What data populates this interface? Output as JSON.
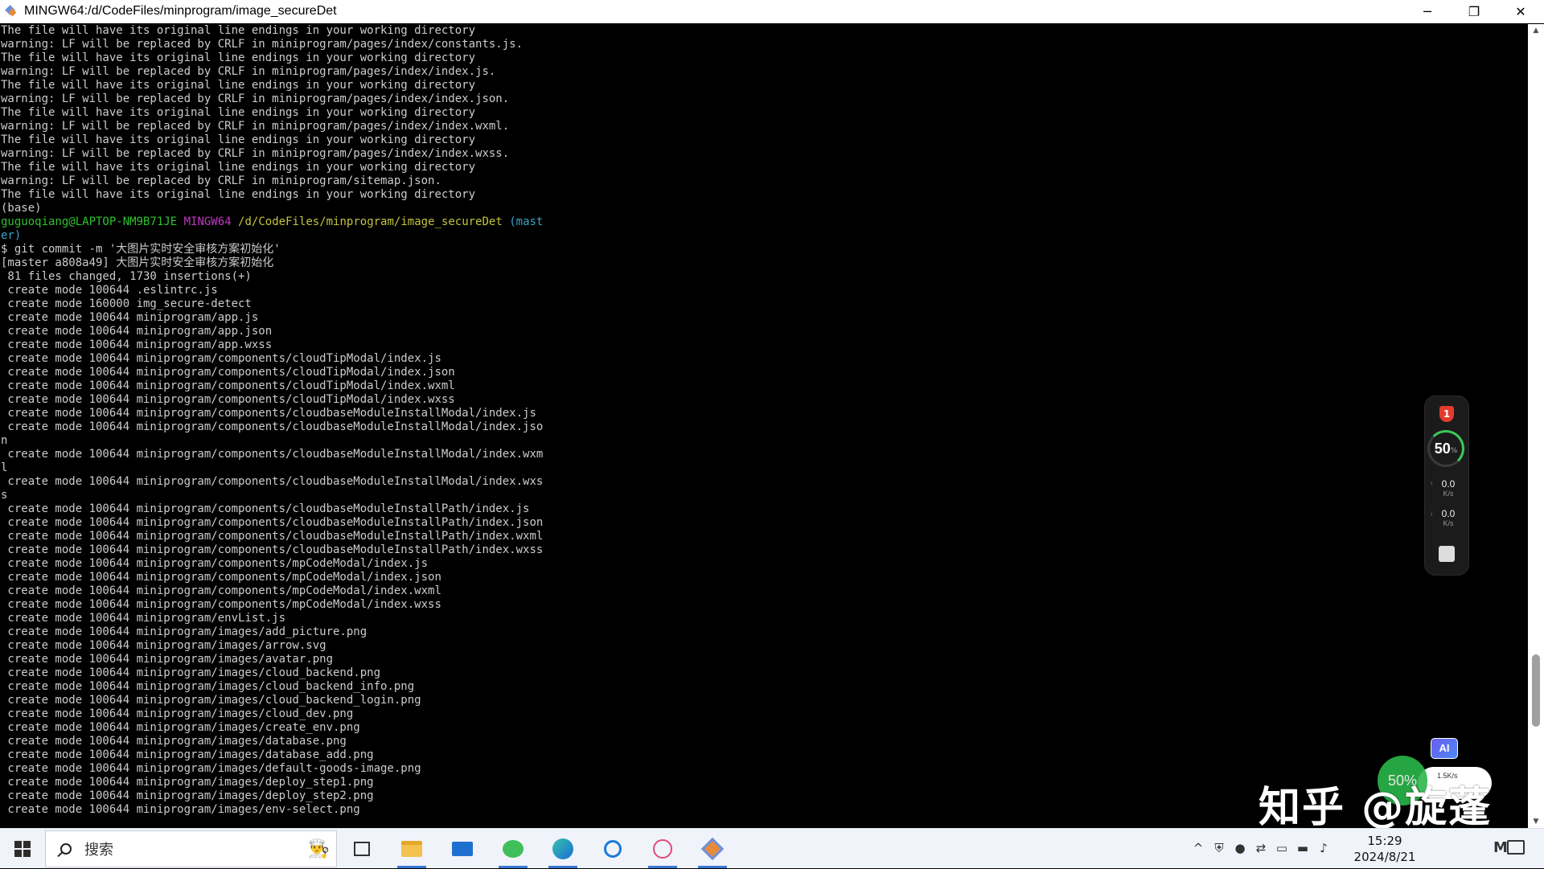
{
  "window": {
    "title": "MINGW64:/d/CodeFiles/minprogram/image_secureDet",
    "controls": {
      "minimize": "─",
      "maximize": "❐",
      "close": "✕"
    }
  },
  "terminal": {
    "lines_before": [
      "The file will have its original line endings in your working directory",
      "warning: LF will be replaced by CRLF in miniprogram/pages/index/constants.js.",
      "The file will have its original line endings in your working directory",
      "warning: LF will be replaced by CRLF in miniprogram/pages/index/index.js.",
      "The file will have its original line endings in your working directory",
      "warning: LF will be replaced by CRLF in miniprogram/pages/index/index.json.",
      "The file will have its original line endings in your working directory",
      "warning: LF will be replaced by CRLF in miniprogram/pages/index/index.wxml.",
      "The file will have its original line endings in your working directory",
      "warning: LF will be replaced by CRLF in miniprogram/pages/index/index.wxss.",
      "The file will have its original line endings in your working directory",
      "warning: LF will be replaced by CRLF in miniprogram/sitemap.json.",
      "The file will have its original line endings in your working directory",
      "(base)"
    ],
    "prompt": {
      "user": "guguoqiang@LAPTOP-NM9B71JE",
      "shell": "MINGW64",
      "path": "/d/CodeFiles/minprogram/image_secureDet",
      "branch_part1": "(mast",
      "branch_part2": "er)"
    },
    "lines_after": [
      "$ git commit -m '大图片实时安全审核方案初始化'",
      "[master a808a49] 大图片实时安全审核方案初始化",
      " 81 files changed, 1730 insertions(+)",
      " create mode 100644 .eslintrc.js",
      " create mode 160000 img_secure-detect",
      " create mode 100644 miniprogram/app.js",
      " create mode 100644 miniprogram/app.json",
      " create mode 100644 miniprogram/app.wxss",
      " create mode 100644 miniprogram/components/cloudTipModal/index.js",
      " create mode 100644 miniprogram/components/cloudTipModal/index.json",
      " create mode 100644 miniprogram/components/cloudTipModal/index.wxml",
      " create mode 100644 miniprogram/components/cloudTipModal/index.wxss",
      " create mode 100644 miniprogram/components/cloudbaseModuleInstallModal/index.js",
      " create mode 100644 miniprogram/components/cloudbaseModuleInstallModal/index.jso",
      "n",
      " create mode 100644 miniprogram/components/cloudbaseModuleInstallModal/index.wxm",
      "l",
      " create mode 100644 miniprogram/components/cloudbaseModuleInstallModal/index.wxs",
      "s",
      " create mode 100644 miniprogram/components/cloudbaseModuleInstallPath/index.js",
      " create mode 100644 miniprogram/components/cloudbaseModuleInstallPath/index.json",
      " create mode 100644 miniprogram/components/cloudbaseModuleInstallPath/index.wxml",
      " create mode 100644 miniprogram/components/cloudbaseModuleInstallPath/index.wxss",
      " create mode 100644 miniprogram/components/mpCodeModal/index.js",
      " create mode 100644 miniprogram/components/mpCodeModal/index.json",
      " create mode 100644 miniprogram/components/mpCodeModal/index.wxml",
      " create mode 100644 miniprogram/components/mpCodeModal/index.wxss",
      " create mode 100644 miniprogram/envList.js",
      " create mode 100644 miniprogram/images/add_picture.png",
      " create mode 100644 miniprogram/images/arrow.svg",
      " create mode 100644 miniprogram/images/avatar.png",
      " create mode 100644 miniprogram/images/cloud_backend.png",
      " create mode 100644 miniprogram/images/cloud_backend_info.png",
      " create mode 100644 miniprogram/images/cloud_backend_login.png",
      " create mode 100644 miniprogram/images/cloud_dev.png",
      " create mode 100644 miniprogram/images/create_env.png",
      " create mode 100644 miniprogram/images/database.png",
      " create mode 100644 miniprogram/images/database_add.png",
      " create mode 100644 miniprogram/images/default-goods-image.png",
      " create mode 100644 miniprogram/images/deploy_step1.png",
      " create mode 100644 miniprogram/images/deploy_step2.png",
      " create mode 100644 miniprogram/images/env-select.png"
    ]
  },
  "monitor_widget": {
    "alert_count": "1",
    "percent": "50",
    "percent_sign": "%",
    "upload": "0.0",
    "download": "0.0",
    "unit": "K/s"
  },
  "ai_badge": "AI",
  "mini_widget": {
    "percent": "50%",
    "speed": "1.5K/s"
  },
  "watermark": "知乎 @旋蓬",
  "taskbar": {
    "search_placeholder": "搜索",
    "time": "15:29",
    "date": "2024/8/21",
    "ime": "M"
  }
}
